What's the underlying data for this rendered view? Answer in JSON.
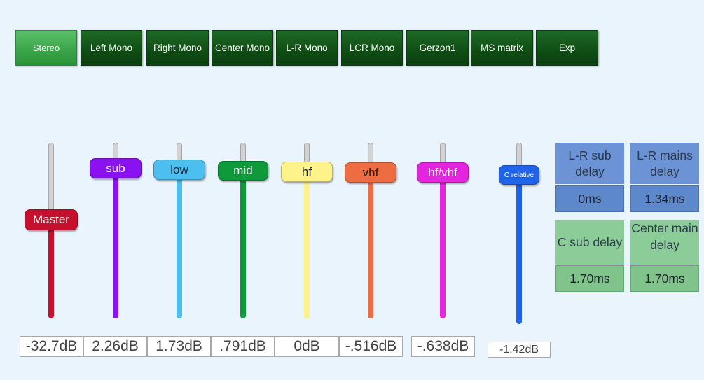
{
  "modes": [
    {
      "label": "Stereo",
      "active": true
    },
    {
      "label": "Left Mono",
      "active": false
    },
    {
      "label": "Right Mono",
      "active": false
    },
    {
      "label": "Center Mono",
      "active": false
    },
    {
      "label": "L-R Mono",
      "active": false
    },
    {
      "label": "LCR Mono",
      "active": false
    },
    {
      "label": "Gerzon1",
      "active": false
    },
    {
      "label": "MS matrix",
      "active": false
    },
    {
      "label": "Exp",
      "active": false
    }
  ],
  "sliders": [
    {
      "label": "Master",
      "readout": "-32.7dB",
      "color": "#c7102e",
      "text_color": "#ffffff"
    },
    {
      "label": "sub",
      "readout": "2.26dB",
      "color": "#8b12f0",
      "text_color": "#ffffff"
    },
    {
      "label": "low",
      "readout": "1.73dB",
      "color": "#4cbef0",
      "text_color": "#1b2a3a"
    },
    {
      "label": "mid",
      "readout": ".791dB",
      "color": "#0e9a3a",
      "text_color": "#ffffff"
    },
    {
      "label": "hf",
      "readout": "0dB",
      "color": "#fdf38a",
      "text_color": "#222222"
    },
    {
      "label": "vhf",
      "readout": "-.516dB",
      "color": "#ee6c42",
      "text_color": "#1b1b1b"
    },
    {
      "label": "hf/vhf",
      "readout": "-.638dB",
      "color": "#e524e0",
      "text_color": "#ffffff"
    },
    {
      "label": "C relative",
      "readout": "-1.42dB",
      "color": "#1f63e8",
      "text_color": "#ffffff"
    }
  ],
  "delays": [
    {
      "label": "L-R sub delay",
      "value": "0ms",
      "color": "#6b93d6",
      "value_color": "#5e88cc"
    },
    {
      "label": "L-R mains delay",
      "value": "1.34ms",
      "color": "#6b93d6",
      "value_color": "#5e88cc"
    },
    {
      "label": "C sub delay",
      "value": "1.70ms",
      "color": "#8ccc98",
      "value_color": "#80c48c"
    },
    {
      "label": "Center main delay",
      "value": "1.70ms",
      "color": "#8ccc98",
      "value_color": "#80c48c"
    }
  ]
}
